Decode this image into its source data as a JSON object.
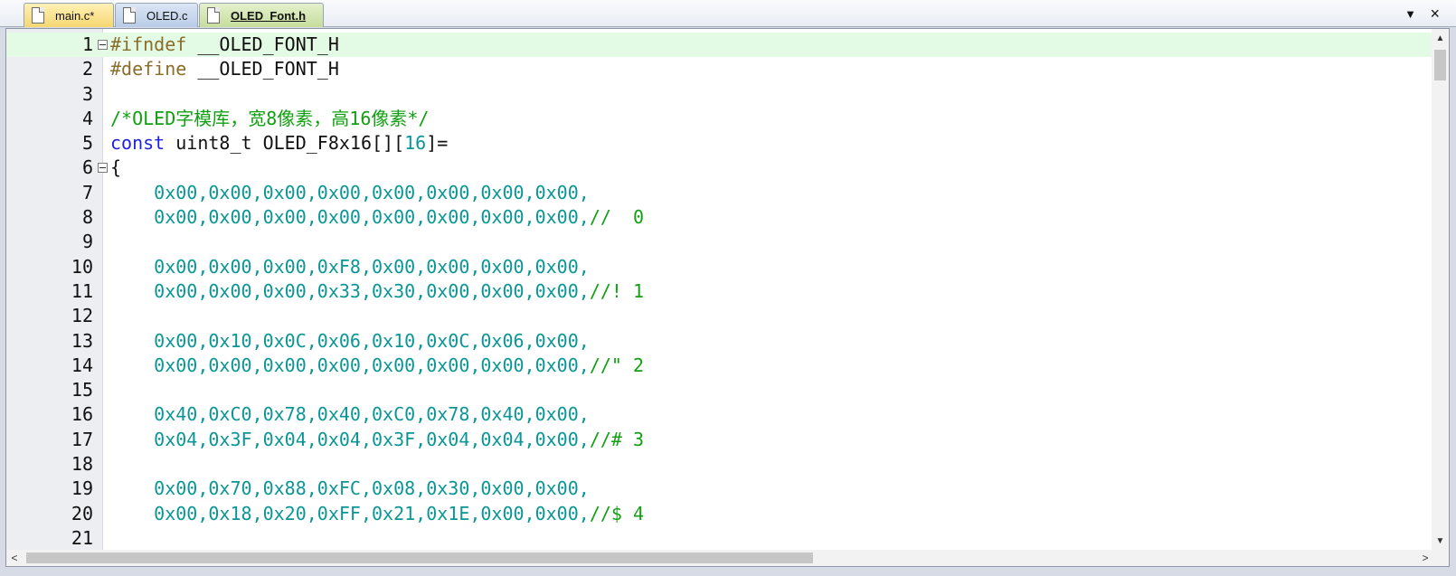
{
  "tabs": [
    {
      "label": "main.c*",
      "active": false
    },
    {
      "label": "OLED.c",
      "active": false
    },
    {
      "label": "OLED_Font.h",
      "active": true
    }
  ],
  "tabbar": {
    "menu_icon": "▼",
    "close_icon": "×"
  },
  "lines": [
    {
      "n": "1",
      "fold": true,
      "current": true,
      "tokens": [
        {
          "t": "#ifndef ",
          "c": "pp"
        },
        {
          "t": "__OLED_FONT_H",
          "c": "pl"
        }
      ]
    },
    {
      "n": "2",
      "tokens": [
        {
          "t": "#define ",
          "c": "pp"
        },
        {
          "t": "__OLED_FONT_H",
          "c": "pl"
        }
      ]
    },
    {
      "n": "3",
      "tokens": []
    },
    {
      "n": "4",
      "tokens": [
        {
          "t": "/*OLED字模库，宽8像素，高16像素*/",
          "c": "cm"
        }
      ]
    },
    {
      "n": "5",
      "tokens": [
        {
          "t": "const",
          "c": "kw"
        },
        {
          "t": " uint8_t OLED_F8x16[][",
          "c": "pl"
        },
        {
          "t": "16",
          "c": "nm"
        },
        {
          "t": "]=",
          "c": "pl"
        }
      ]
    },
    {
      "n": "6",
      "fold": true,
      "tokens": [
        {
          "t": "{",
          "c": "pl"
        }
      ]
    },
    {
      "n": "7",
      "tokens": [
        {
          "t": "    0x00,0x00,0x00,0x00,0x00,0x00,0x00,0x00,",
          "c": "nm"
        }
      ]
    },
    {
      "n": "8",
      "tokens": [
        {
          "t": "    0x00,0x00,0x00,0x00,0x00,0x00,0x00,0x00,",
          "c": "nm"
        },
        {
          "t": "//  0",
          "c": "cm"
        }
      ]
    },
    {
      "n": "9",
      "tokens": []
    },
    {
      "n": "10",
      "tokens": [
        {
          "t": "    0x00,0x00,0x00,0xF8,0x00,0x00,0x00,0x00,",
          "c": "nm"
        }
      ]
    },
    {
      "n": "11",
      "tokens": [
        {
          "t": "    0x00,0x00,0x00,0x33,0x30,0x00,0x00,0x00,",
          "c": "nm"
        },
        {
          "t": "//! 1",
          "c": "cm"
        }
      ]
    },
    {
      "n": "12",
      "tokens": []
    },
    {
      "n": "13",
      "tokens": [
        {
          "t": "    0x00,0x10,0x0C,0x06,0x10,0x0C,0x06,0x00,",
          "c": "nm"
        }
      ]
    },
    {
      "n": "14",
      "tokens": [
        {
          "t": "    0x00,0x00,0x00,0x00,0x00,0x00,0x00,0x00,",
          "c": "nm"
        },
        {
          "t": "//\" 2",
          "c": "cm"
        }
      ]
    },
    {
      "n": "15",
      "tokens": []
    },
    {
      "n": "16",
      "tokens": [
        {
          "t": "    0x40,0xC0,0x78,0x40,0xC0,0x78,0x40,0x00,",
          "c": "nm"
        }
      ]
    },
    {
      "n": "17",
      "tokens": [
        {
          "t": "    0x04,0x3F,0x04,0x04,0x3F,0x04,0x04,0x00,",
          "c": "nm"
        },
        {
          "t": "//# 3",
          "c": "cm"
        }
      ]
    },
    {
      "n": "18",
      "tokens": []
    },
    {
      "n": "19",
      "tokens": [
        {
          "t": "    0x00,0x70,0x88,0xFC,0x08,0x30,0x00,0x00,",
          "c": "nm"
        }
      ]
    },
    {
      "n": "20",
      "tokens": [
        {
          "t": "    0x00,0x18,0x20,0xFF,0x21,0x1E,0x00,0x00,",
          "c": "nm"
        },
        {
          "t": "//$ 4",
          "c": "cm"
        }
      ]
    },
    {
      "n": "21",
      "tokens": []
    }
  ],
  "scroll": {
    "up": "▲",
    "down": "▼",
    "left": "<",
    "right": ">"
  }
}
